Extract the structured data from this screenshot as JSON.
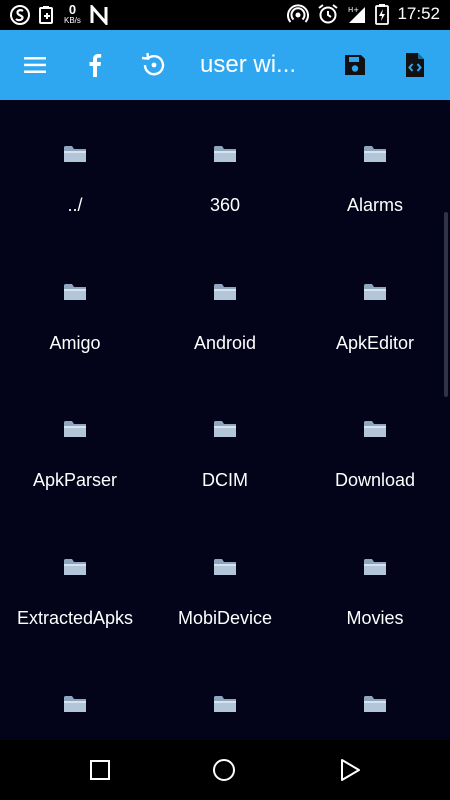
{
  "status_bar": {
    "net_speed_value": "0",
    "net_speed_unit": "KB/s",
    "time": "17:52",
    "left_icons": [
      "s-app-icon",
      "battery-saver-icon",
      "netspeed-meter",
      "n-app-icon"
    ],
    "right_icons": [
      "hotspot-icon",
      "alarm-clock-icon",
      "signal-icon",
      "battery-icon"
    ]
  },
  "app_bar": {
    "title": "user wi...",
    "background": "#2fa6f0",
    "icons": [
      "menu-icon",
      "facebook-icon",
      "restore-icon",
      "save-icon",
      "code-file-icon"
    ]
  },
  "folders": [
    {
      "name": "../"
    },
    {
      "name": "360"
    },
    {
      "name": "Alarms"
    },
    {
      "name": "Amigo"
    },
    {
      "name": "Android"
    },
    {
      "name": "ApkEditor"
    },
    {
      "name": "ApkParser"
    },
    {
      "name": "DCIM"
    },
    {
      "name": "Download"
    },
    {
      "name": "ExtractedApks"
    },
    {
      "name": "MobiDevice"
    },
    {
      "name": "Movies"
    },
    {
      "name": ""
    },
    {
      "name": ""
    },
    {
      "name": ""
    }
  ],
  "nav_bar": {
    "buttons": [
      "recents-button",
      "home-button",
      "back-button"
    ]
  }
}
